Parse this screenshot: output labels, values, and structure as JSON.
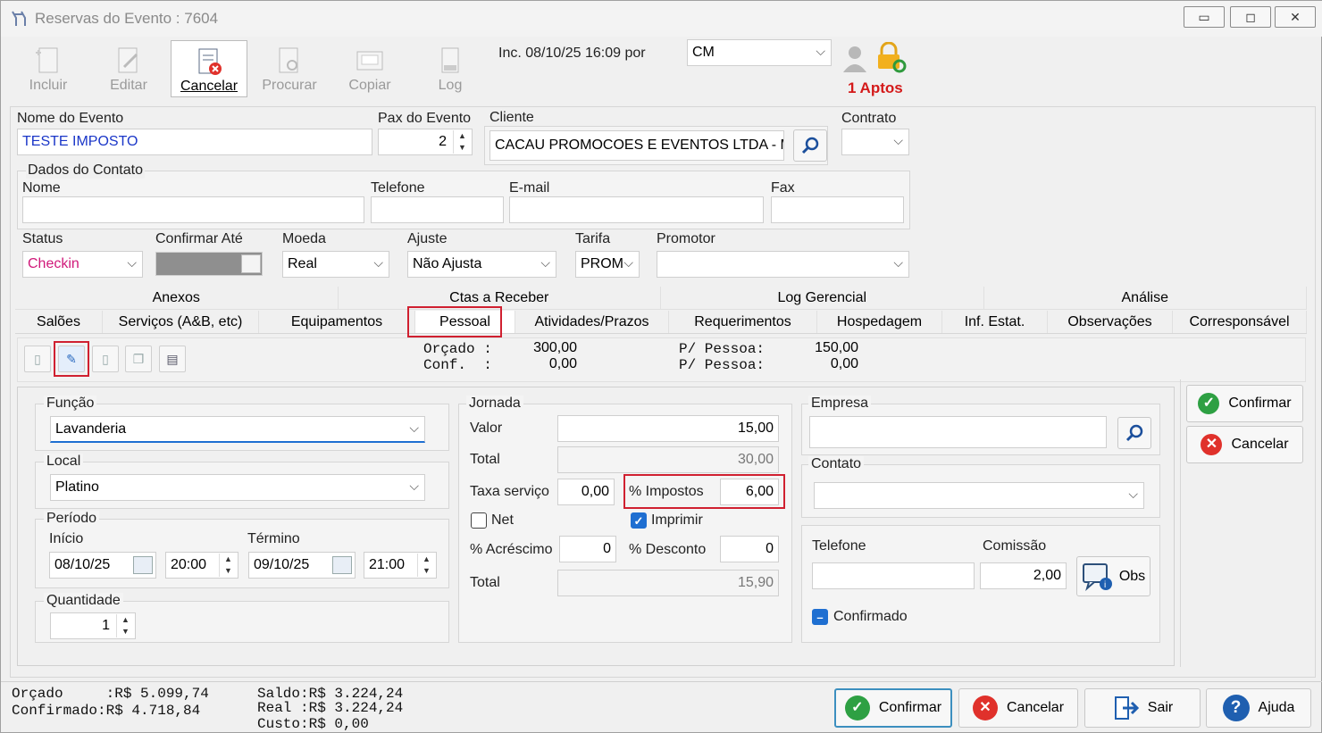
{
  "window": {
    "title": "Reservas do Evento : 7604",
    "minimize": "▭",
    "maximize": "◻",
    "close": "✕"
  },
  "toolbar": {
    "incluir": "Incluir",
    "editar": "Editar",
    "cancelar": "Cancelar",
    "procurar": "Procurar",
    "copiar": "Copiar",
    "log": "Log",
    "inc_info": "Inc. 08/10/25 16:09 por",
    "user_select": "CM",
    "aptos": "1 Aptos"
  },
  "header": {
    "nome_evento_label": "Nome do Evento",
    "nome_evento": "TESTE IMPOSTO",
    "pax_label": "Pax do Evento",
    "pax": "2",
    "cliente_label": "Cliente",
    "cliente": "CACAU PROMOCOES E EVENTOS LTDA - M",
    "contrato_label": "Contrato",
    "contrato": ""
  },
  "contato": {
    "section_label": "Dados do Contato",
    "nome_label": "Nome",
    "telefone_label": "Telefone",
    "email_label": "E-mail",
    "fax_label": "Fax",
    "nome": "",
    "telefone": "",
    "email": "",
    "fax": ""
  },
  "status_row": {
    "status_label": "Status",
    "status": "Checkin",
    "confirmar_label": "Confirmar Até",
    "moeda_label": "Moeda",
    "moeda": "Real",
    "ajuste_label": "Ajuste",
    "ajuste": "Não Ajusta",
    "tarifa_label": "Tarifa",
    "tarifa": "PROM",
    "promotor_label": "Promotor",
    "promotor": ""
  },
  "tabs_top": [
    "Anexos",
    "Ctas a Receber",
    "Log Gerencial",
    "Análise"
  ],
  "tabs_bottom": [
    "Salões",
    "Serviços (A&B, etc)",
    "Equipamentos",
    "Pessoal",
    "Atividades/Prazos",
    "Requerimentos",
    "Hospedagem",
    "Inf. Estat.",
    "Observações",
    "Corresponsável"
  ],
  "summary": {
    "orcado_label": "Orçado :",
    "orcado": "300,00",
    "conf_label": "Conf.  :",
    "conf": "0,00",
    "pp1_label": "P/ Pessoa:",
    "pp1": "150,00",
    "pp2_label": "P/ Pessoa:",
    "pp2": "0,00"
  },
  "form": {
    "funcao_label": "Função",
    "funcao": "Lavanderia",
    "local_label": "Local",
    "local": "Platino",
    "periodo_label": "Período",
    "inicio_label": "Início",
    "termino_label": "Término",
    "inicio_data": "08/10/25",
    "inicio_hora": "20:00",
    "termino_data": "09/10/25",
    "termino_hora": "21:00",
    "quantidade_label": "Quantidade",
    "quantidade": "1",
    "jornada_label": "Jornada",
    "valor_label": "Valor",
    "valor": "15,00",
    "total_label": "Total",
    "total": "30,00",
    "taxa_label": "Taxa serviço",
    "taxa": "0,00",
    "impostos_label": "% Impostos",
    "impostos": "6,00",
    "net_label": "Net",
    "imprimir_label": "Imprimir",
    "acrescimo_label": "% Acréscimo",
    "acrescimo": "0",
    "desconto_label": "% Desconto",
    "desconto": "0",
    "total2_label": "Total",
    "total2": "15,90",
    "empresa_label": "Empresa",
    "empresa": "",
    "contato_label": "Contato",
    "contato": "",
    "telefone_label": "Telefone",
    "telefone": "",
    "comissao_label": "Comissão",
    "comissao": "2,00",
    "obs_label": "Obs",
    "confirmado_label": "Confirmado"
  },
  "side_buttons": {
    "confirmar": "Confirmar",
    "cancelar": "Cancelar"
  },
  "footer": {
    "line1": "Orçado     :R$ 5.099,74",
    "line2": "Confirmado:R$ 4.718,84",
    "saldo": "Saldo:R$ 3.224,24",
    "real": "Real :R$ 3.224,24",
    "custo": "Custo:R$ 0,00",
    "confirmar": "Confirmar",
    "cancelar": "Cancelar",
    "sair": "Sair",
    "ajuda": "Ajuda"
  }
}
